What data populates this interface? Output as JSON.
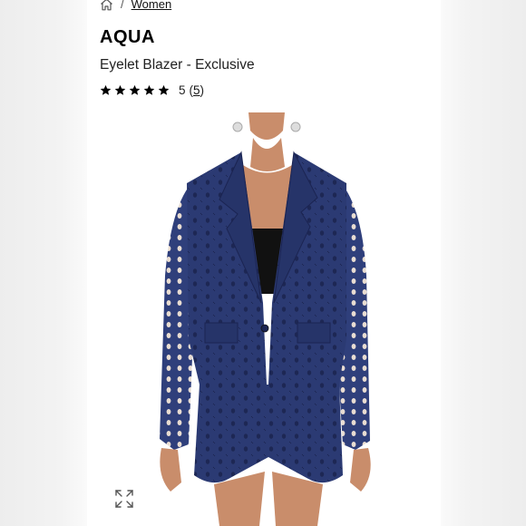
{
  "breadcrumb": {
    "home_icon": "home-icon",
    "separator": "/",
    "category": "Women"
  },
  "product": {
    "brand": "AQUA",
    "title": "Eyelet Blazer - Exclusive",
    "rating": {
      "stars": 5,
      "value": "5",
      "count_open": "(",
      "count": "5",
      "count_close": ")"
    }
  },
  "image": {
    "expand_icon": "expand-arrows-icon",
    "garment_color": "#2b3a73"
  }
}
